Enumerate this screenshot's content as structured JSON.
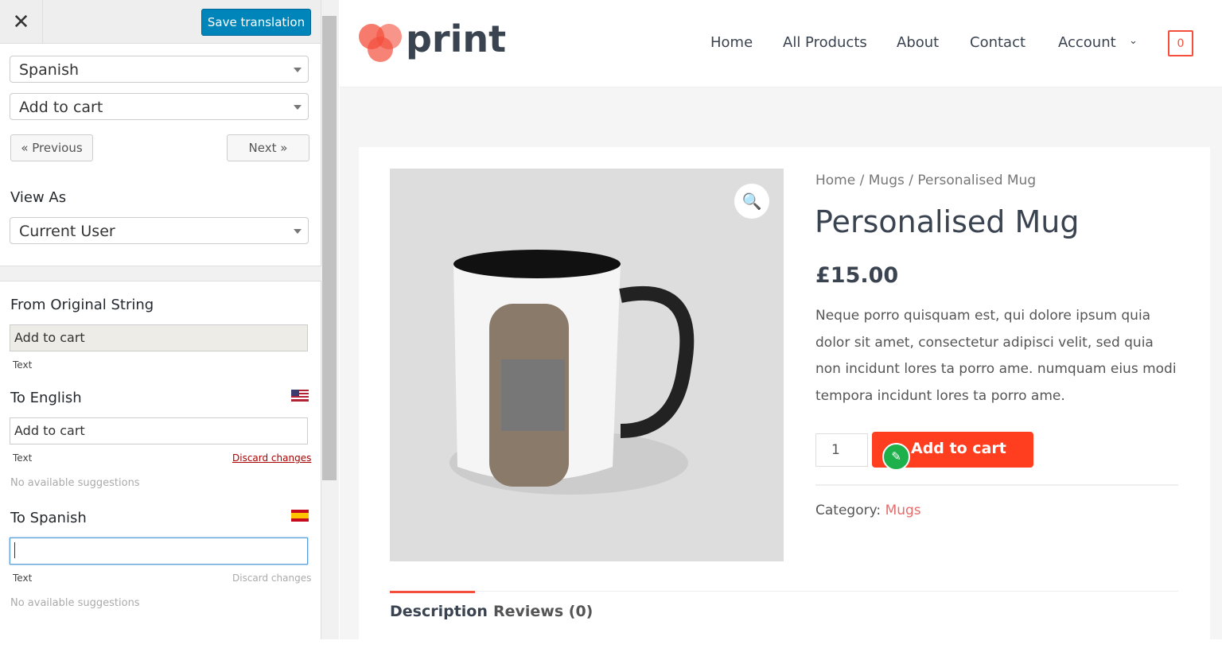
{
  "editor": {
    "close_icon": "close-icon",
    "save_label": "Save translation",
    "language_select": "Spanish",
    "string_select": "Add to cart",
    "previous_label": "« Previous",
    "next_label": "Next »",
    "view_as_label": "View As",
    "view_as_select": "Current User",
    "original_label": "From Original String",
    "original_value": "Add to cart",
    "original_type": "Text",
    "english_label": "To English",
    "english_value": "Add to cart",
    "english_type": "Text",
    "english_discard": "Discard changes",
    "english_suggestions": "No available suggestions",
    "spanish_label": "To Spanish",
    "spanish_value": "",
    "spanish_type": "Text",
    "spanish_discard": "Discard changes",
    "spanish_suggestions": "No available suggestions",
    "accent": "#0085ba"
  },
  "site": {
    "logo_text": "print",
    "nav": [
      "Home",
      "All Products",
      "About",
      "Contact",
      "Account"
    ],
    "cart_count": "0",
    "accent": "#f44f3c",
    "breadcrumb": [
      "Home",
      "Mugs",
      "Personalised Mug"
    ],
    "title": "Personalised Mug",
    "price": "£15.00",
    "description": "Neque porro quisquam est, qui dolore ipsum quia dolor sit amet, consectetur adipisci velit, sed quia non incidunt lores ta porro ame. numquam eius modi tempora incidunt lores ta porro ame.",
    "quantity": "1",
    "add_to_cart": "Add to cart",
    "category_label": "Category:",
    "category_value": "Mugs",
    "tabs": [
      "Description",
      "Reviews (0)"
    ]
  }
}
